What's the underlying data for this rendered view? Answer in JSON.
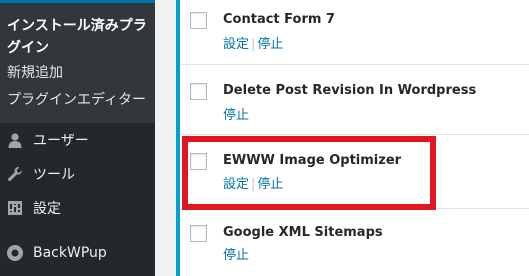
{
  "sidebar": {
    "submenu": {
      "current": "インストール済みプラ\nグイン",
      "items": [
        {
          "label": "新規追加"
        },
        {
          "label": "プラグインエディター"
        }
      ]
    },
    "menu": [
      {
        "label": "ユーザー",
        "icon": "user-icon"
      },
      {
        "label": "ツール",
        "icon": "wrench-icon"
      },
      {
        "label": "設定",
        "icon": "settings-icon"
      },
      {
        "label": "BackWPup",
        "icon": "backwpup-icon"
      }
    ]
  },
  "plugins": [
    {
      "name": "Contact Form 7",
      "actions": [
        "設定",
        "停止"
      ]
    },
    {
      "name": "Delete Post Revision In Wordpress",
      "actions": [
        "停止"
      ]
    },
    {
      "name": "EWWW Image Optimizer",
      "actions": [
        "設定",
        "停止"
      ]
    },
    {
      "name": "Google XML Sitemaps",
      "actions": [
        "停止"
      ]
    }
  ],
  "colors": {
    "sidebar_bg": "#23282d",
    "submenu_bg": "#32373c",
    "accent": "#00a0d2",
    "link": "#0073aa",
    "highlight": "#e3161f"
  }
}
